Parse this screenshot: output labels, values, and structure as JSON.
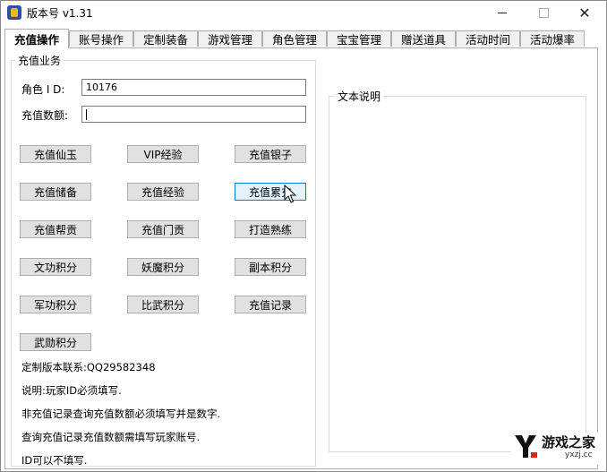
{
  "window": {
    "title": "版本号 v1.31"
  },
  "tabs": [
    "充值操作",
    "账号操作",
    "定制装备",
    "游戏管理",
    "角色管理",
    "宝宝管理",
    "赠送道具",
    "活动时间",
    "活动爆率"
  ],
  "recharge_group": {
    "title": "充值业务",
    "role_id_label": "角色 I D:",
    "role_id_value": "10176",
    "amount_label": "充值数额:",
    "amount_value": ""
  },
  "buttons": [
    [
      "充值仙玉",
      "VIP经验",
      "充值银子"
    ],
    [
      "充值储备",
      "充值经验",
      "充值累充"
    ],
    [
      "充值帮贡",
      "充值门贡",
      "打造熟练"
    ],
    [
      "文功积分",
      "妖魔积分",
      "副本积分"
    ],
    [
      "军功积分",
      "比武积分",
      "充值记录"
    ],
    [
      "武勋积分"
    ]
  ],
  "notes": [
    "定制版本联系:QQ29582348",
    "说明:玩家ID必须填写.",
    "非充值记录查询充值数额必须填写并是数字.",
    "查询充值记录充值数额需填写玩家账号.",
    "ID可以不填写."
  ],
  "text_group": {
    "title": "文本说明"
  },
  "watermark": {
    "name": "游戏之家",
    "url": "yxzj.cc"
  },
  "colors": {
    "hover_border": "#0078d7",
    "button_bg": "#e1e1e1",
    "tab_bg": "#f0f0f0"
  }
}
